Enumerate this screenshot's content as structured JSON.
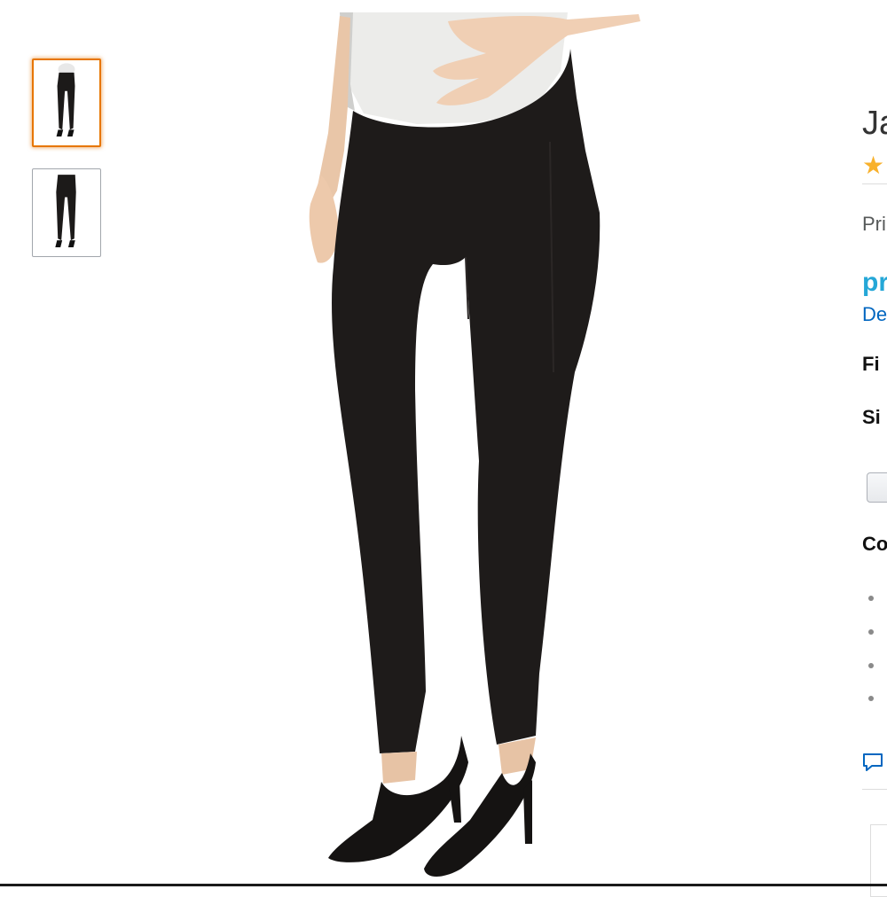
{
  "gallery": {
    "thumbnails": [
      {
        "name": "front view",
        "selected": true
      },
      {
        "name": "back view",
        "selected": false
      }
    ],
    "main_image": "model wearing black maternity skinny pants with over-belly panel, white top and black patent heels"
  },
  "product": {
    "title": "Ja",
    "stars": "★",
    "price_label": "Pri",
    "prime": "pr",
    "delivery_link": "De",
    "fit_label": "Fi",
    "size_label": "Si",
    "color_label": "Co"
  },
  "colors": {
    "accent": "#e77600",
    "star": "#f8b12c",
    "prime": "#25a7d7",
    "link": "#0066c0"
  },
  "icons": {
    "rating": "star-icon",
    "feedback": "speech-bubble-icon"
  }
}
